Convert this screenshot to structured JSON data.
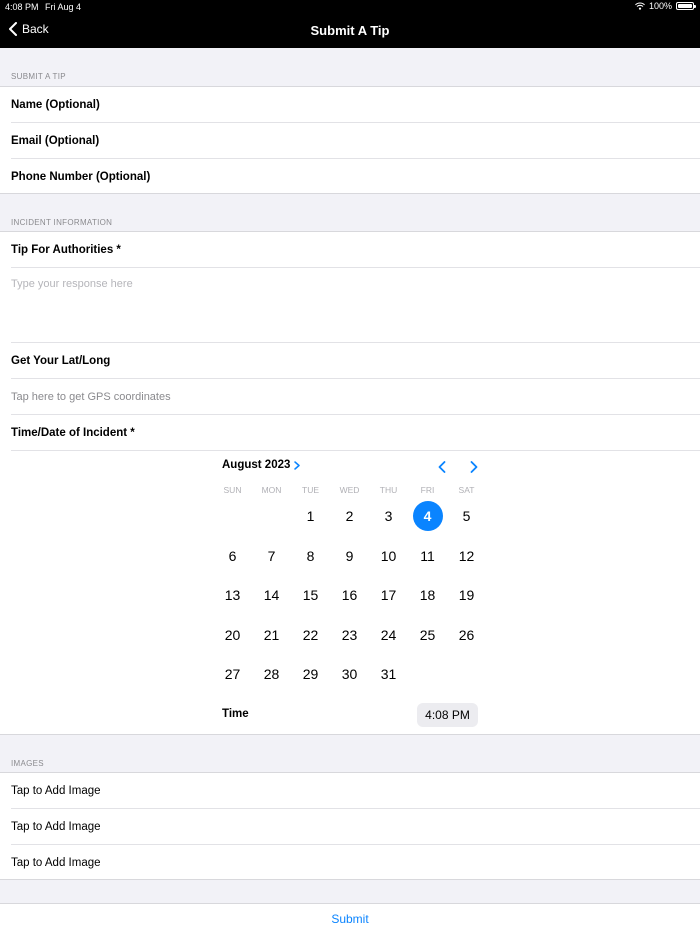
{
  "status_bar": {
    "time": "4:08 PM",
    "date": "Fri Aug 4",
    "battery": "100%"
  },
  "nav": {
    "back_label": "Back",
    "title": "Submit A Tip"
  },
  "contact_section": {
    "header": "SUBMIT A TIP",
    "rows": [
      "Name (Optional)",
      "Email (Optional)",
      "Phone Number (Optional)"
    ]
  },
  "incident_section": {
    "header": "INCIDENT INFORMATION",
    "tip_label": "Tip For Authorities *",
    "tip_placeholder": "Type your response here",
    "latlong_label": "Get Your Lat/Long",
    "latlong_placeholder": "Tap here to get GPS coordinates",
    "datetime_label": "Time/Date of Incident *"
  },
  "calendar": {
    "month_label": "August 2023",
    "weekdays": [
      "SUN",
      "MON",
      "TUE",
      "WED",
      "THU",
      "FRI",
      "SAT"
    ],
    "weeks": [
      [
        "",
        "",
        "1",
        "2",
        "3",
        "4",
        "5"
      ],
      [
        "6",
        "7",
        "8",
        "9",
        "10",
        "11",
        "12"
      ],
      [
        "13",
        "14",
        "15",
        "16",
        "17",
        "18",
        "19"
      ],
      [
        "20",
        "21",
        "22",
        "23",
        "24",
        "25",
        "26"
      ],
      [
        "27",
        "28",
        "29",
        "30",
        "31",
        "",
        ""
      ]
    ],
    "selected_day": "4",
    "time_label": "Time",
    "time_value": "4:08 PM"
  },
  "images_section": {
    "header": "IMAGES",
    "rows": [
      "Tap to Add Image",
      "Tap to Add Image",
      "Tap to Add Image"
    ]
  },
  "submit_label": "Submit",
  "colors": {
    "accent": "#0a84ff",
    "nav_bg": "#000000",
    "page_bg": "#f2f2f7"
  },
  "icons": [
    "wifi-icon",
    "battery-icon",
    "chevron-left-icon",
    "chevron-right-icon"
  ]
}
